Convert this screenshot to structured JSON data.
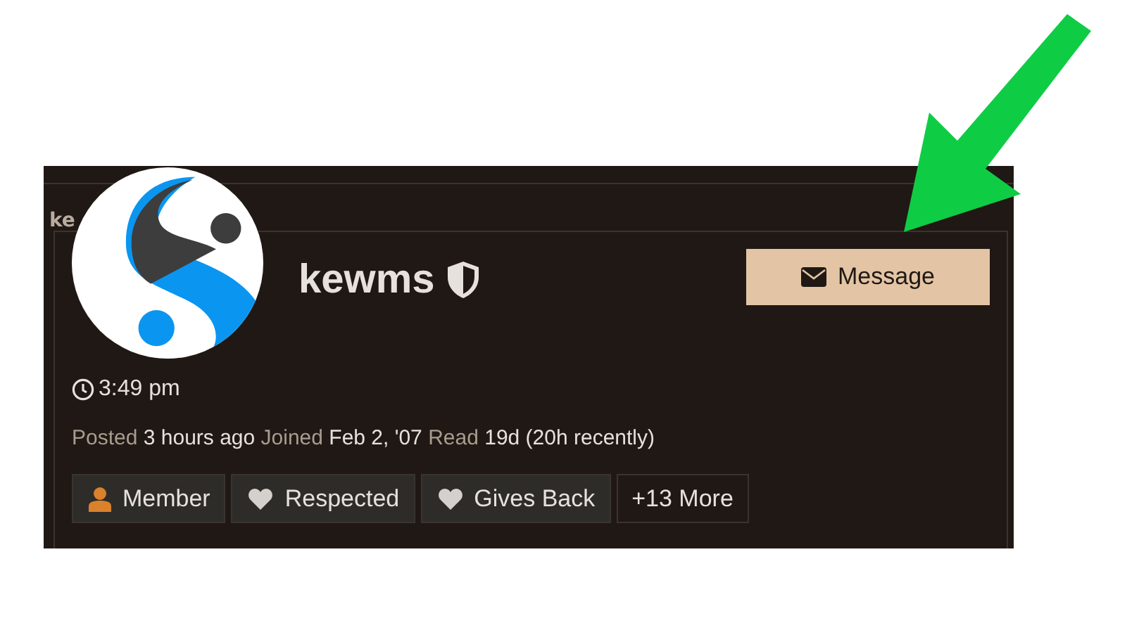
{
  "behind_label": "ke",
  "user": {
    "name": "kewms",
    "time": "3:49 pm"
  },
  "message_button": {
    "label": "Message"
  },
  "meta": [
    {
      "label": "Posted",
      "value": "3 hours ago"
    },
    {
      "label": "Joined",
      "value": "Feb 2, '07"
    },
    {
      "label": "Read",
      "value": "19d (20h recently)"
    }
  ],
  "badges": [
    {
      "kind": "person",
      "label": "Member"
    },
    {
      "kind": "heart",
      "label": "Respected"
    },
    {
      "kind": "heart",
      "label": "Gives Back"
    },
    {
      "kind": "more",
      "label": "+13 More"
    }
  ]
}
